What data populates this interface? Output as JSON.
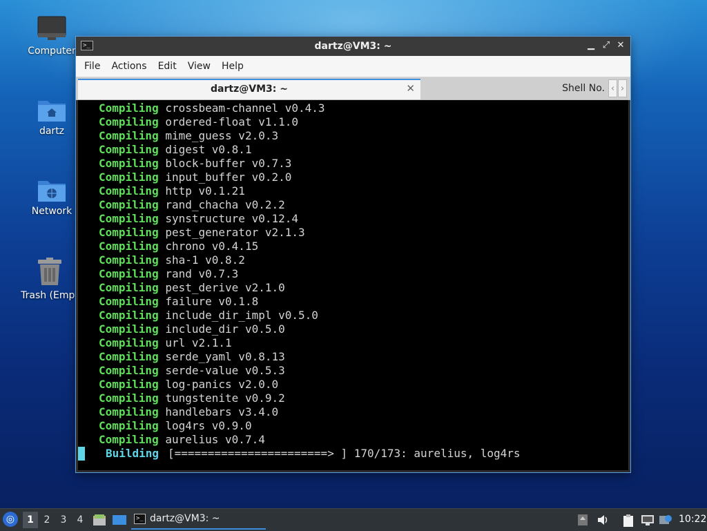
{
  "desktop": {
    "icons": [
      {
        "label": "Computer",
        "icon": "computer-icon"
      },
      {
        "label": "dartz",
        "icon": "home-folder-icon"
      },
      {
        "label": "Network",
        "icon": "network-folder-icon"
      },
      {
        "label": "Trash (Empt",
        "icon": "trash-icon"
      }
    ]
  },
  "window": {
    "title": "dartz@VM3: ~",
    "controls": {
      "minimize": "▁",
      "maximize": "⤢",
      "close": "✕"
    },
    "menu": [
      "File",
      "Actions",
      "Edit",
      "View",
      "Help"
    ],
    "tabs": [
      {
        "label": "dartz@VM3: ~",
        "active": true,
        "close": "✕"
      },
      {
        "label": "Shell No.",
        "active": false
      }
    ],
    "tab_scroll": {
      "left": "‹",
      "right": "›"
    }
  },
  "terminal": {
    "lines": [
      {
        "keyword": "Compiling",
        "text": "crossbeam-channel v0.4.3"
      },
      {
        "keyword": "Compiling",
        "text": "ordered-float v1.1.0"
      },
      {
        "keyword": "Compiling",
        "text": "mime_guess v2.0.3"
      },
      {
        "keyword": "Compiling",
        "text": "digest v0.8.1"
      },
      {
        "keyword": "Compiling",
        "text": "block-buffer v0.7.3"
      },
      {
        "keyword": "Compiling",
        "text": "input_buffer v0.2.0"
      },
      {
        "keyword": "Compiling",
        "text": "http v0.1.21"
      },
      {
        "keyword": "Compiling",
        "text": "rand_chacha v0.2.2"
      },
      {
        "keyword": "Compiling",
        "text": "synstructure v0.12.4"
      },
      {
        "keyword": "Compiling",
        "text": "pest_generator v2.1.3"
      },
      {
        "keyword": "Compiling",
        "text": "chrono v0.4.15"
      },
      {
        "keyword": "Compiling",
        "text": "sha-1 v0.8.2"
      },
      {
        "keyword": "Compiling",
        "text": "rand v0.7.3"
      },
      {
        "keyword": "Compiling",
        "text": "pest_derive v2.1.0"
      },
      {
        "keyword": "Compiling",
        "text": "failure v0.1.8"
      },
      {
        "keyword": "Compiling",
        "text": "include_dir_impl v0.5.0"
      },
      {
        "keyword": "Compiling",
        "text": "include_dir v0.5.0"
      },
      {
        "keyword": "Compiling",
        "text": "url v2.1.1"
      },
      {
        "keyword": "Compiling",
        "text": "serde_yaml v0.8.13"
      },
      {
        "keyword": "Compiling",
        "text": "serde-value v0.5.3"
      },
      {
        "keyword": "Compiling",
        "text": "log-panics v2.0.0"
      },
      {
        "keyword": "Compiling",
        "text": "tungstenite v0.9.2"
      },
      {
        "keyword": "Compiling",
        "text": "handlebars v3.4.0"
      },
      {
        "keyword": "Compiling",
        "text": "log4rs v0.9.0"
      },
      {
        "keyword": "Compiling",
        "text": "aurelius v0.7.4"
      }
    ],
    "building": {
      "keyword": "Building",
      "text": "[=======================> ] 170/173: aurelius, log4rs"
    }
  },
  "taskbar": {
    "workspaces": [
      "1",
      "2",
      "3",
      "4"
    ],
    "active_workspace": "1",
    "task_label": "dartz@VM3: ~",
    "clock": "10:22"
  },
  "colors": {
    "compiling": "#5fe05a",
    "building": "#5ed6e8",
    "accent": "#3b8ee0"
  }
}
